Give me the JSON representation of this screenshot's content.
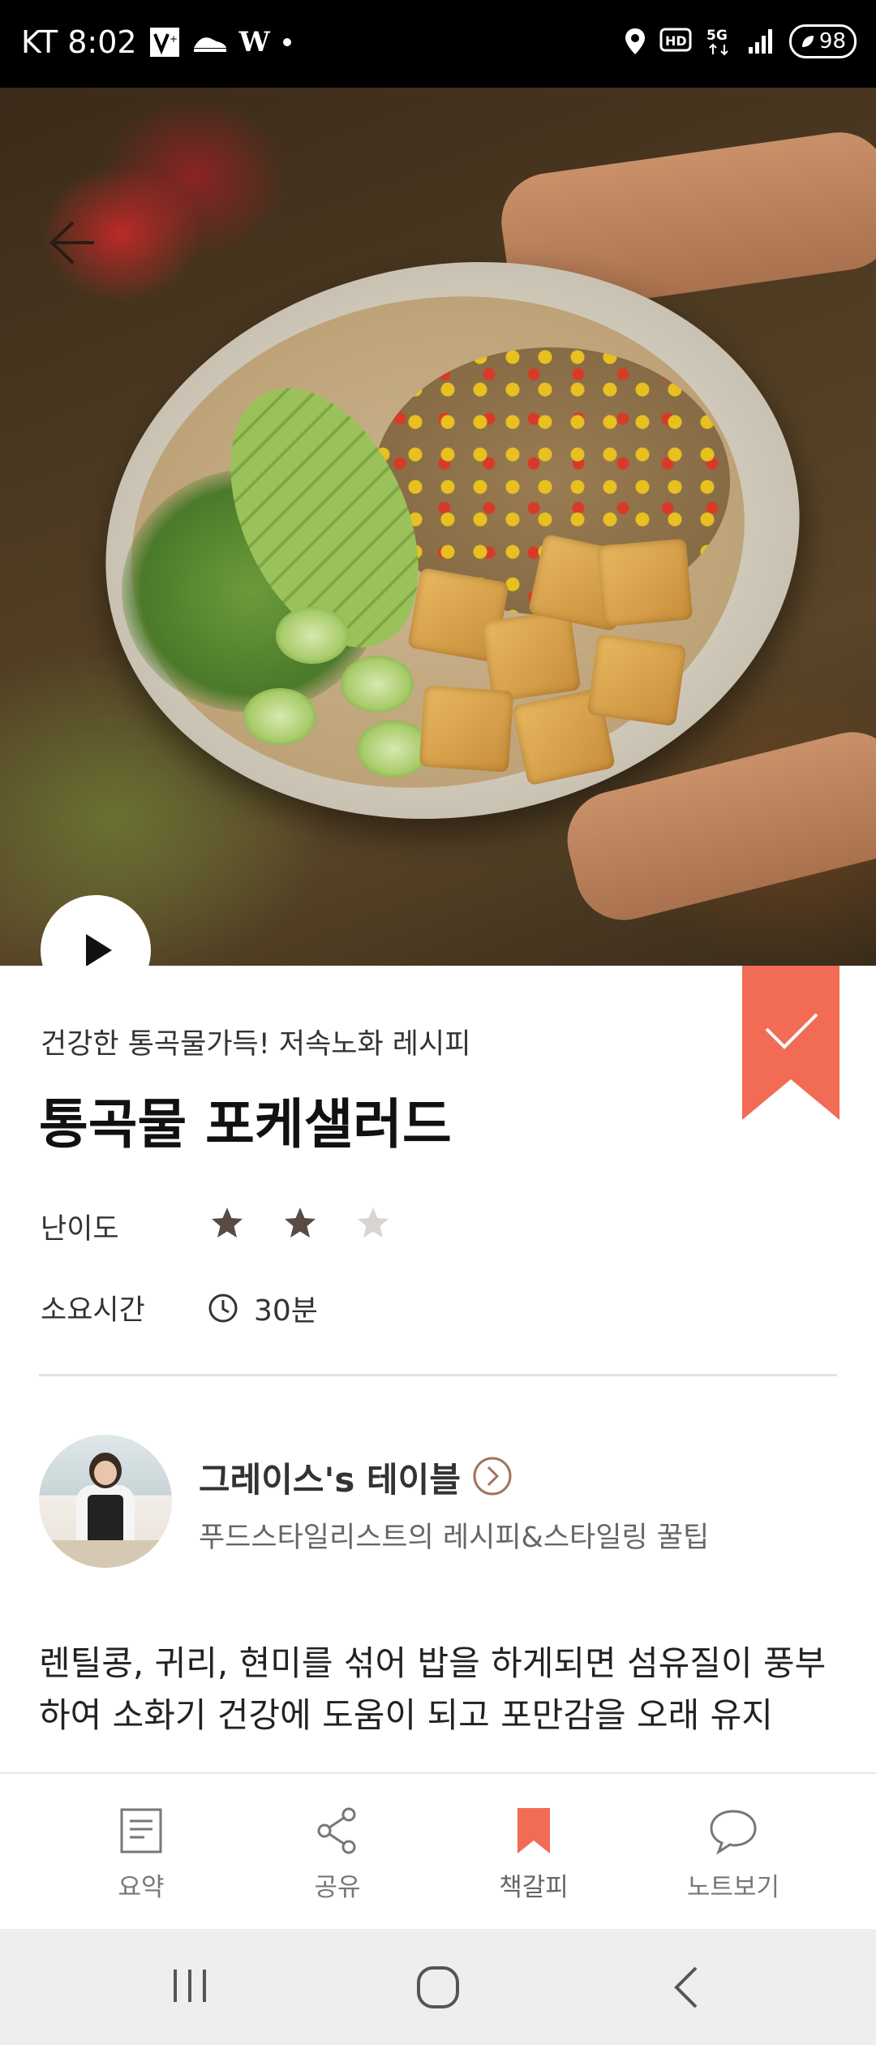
{
  "status_bar": {
    "carrier_time": "KT 8:02",
    "battery": "98",
    "network": "5G",
    "hd": "HD"
  },
  "recipe": {
    "subtitle": "건강한 통곡물가득! 저속노화 레시피",
    "title": "통곡물 포케샐러드",
    "difficulty_label": "난이도",
    "difficulty_rating": 2,
    "difficulty_max": 3,
    "time_label": "소요시간",
    "time_value": "30분",
    "bookmarked": true,
    "description": "렌틸콩, 귀리, 현미를 섞어 밥을 하게되면 섬유질이 풍부하여 소화기 건강에 도움이 되고 포만감을 오래 유지"
  },
  "author": {
    "name": "그레이스's 테이블",
    "description": "푸드스타일리스트의 레시피&스타일링 꿀팁"
  },
  "toolbar": {
    "items": [
      {
        "label": "요약",
        "icon": "document-icon"
      },
      {
        "label": "공유",
        "icon": "share-icon"
      },
      {
        "label": "책갈피",
        "icon": "bookmark-icon"
      },
      {
        "label": "노트보기",
        "icon": "speech-bubble-icon"
      }
    ]
  },
  "colors": {
    "accent": "#f26b55",
    "star_active": "#5a4a45",
    "star_inactive": "#d9d4d2"
  }
}
